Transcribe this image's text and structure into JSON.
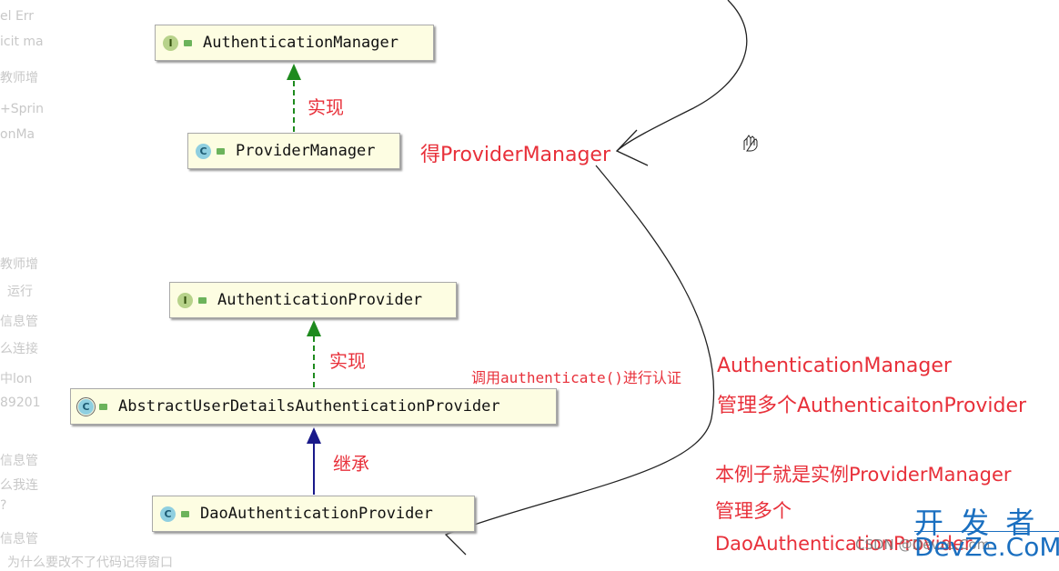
{
  "sidebar_fragments": [
    "el Err",
    "icit ma",
    "教师增",
    "+Sprin",
    "onMa",
    "教师增",
    "运行",
    "信息管",
    "么连接",
    "中lon",
    "89201",
    "信息管",
    "么我连",
    "?",
    "信息管",
    "为什么要改不了代码记得窗口"
  ],
  "classes": [
    {
      "kind": "I",
      "name": "AuthenticationManager"
    },
    {
      "kind": "C",
      "name": "ProviderManager"
    },
    {
      "kind": "I",
      "name": "AuthenticationProvider"
    },
    {
      "kind": "C",
      "name": "AbstractUserDetailsAuthenticationProvider"
    },
    {
      "kind": "C",
      "name": "DaoAuthenticationProvider"
    }
  ],
  "relations": {
    "implements1": "实现",
    "implements2": "实现",
    "extends": "继承"
  },
  "annotations": {
    "get_provider_manager": "得ProviderManager",
    "call_authenticate": "调用authenticate()进行认证",
    "manager_line1": "AuthenticationManager",
    "manager_line2": "管理多个AuthenticaitonProvider",
    "example_line1": "本例子就是实例ProviderManager",
    "example_line2": "管理多个",
    "example_line3": "DaoAuthenticationProvider"
  },
  "watermark": {
    "csdn": "CSDN @Devze.Com",
    "brand_cn": "开 发 者",
    "brand_en": "DevZe.CoM"
  },
  "colors": {
    "annotation": "#e8303a",
    "implements_arrow": "#1e8a1e",
    "extends_arrow": "#1a1a8a",
    "class_bg": "#fdfde2",
    "watermark": "#1a6fc0"
  }
}
